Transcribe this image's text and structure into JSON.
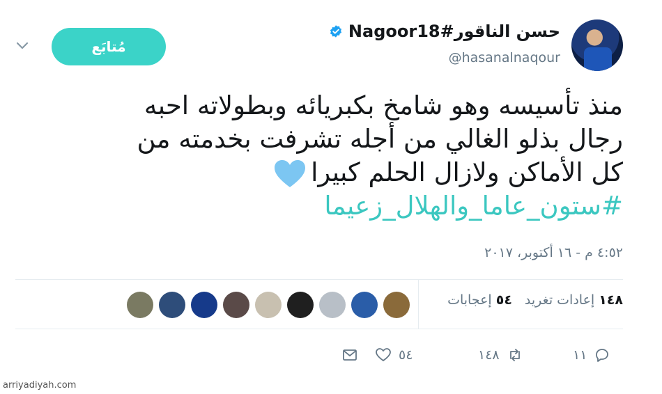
{
  "header": {
    "display_name": "حسن الناقور#Nagoor18",
    "handle": "@hasanalnaqour",
    "follow_label": "مُتابَع",
    "verified": true
  },
  "tweet": {
    "lines": [
      "منذ تأسيسه وهو شامخ بكبريائه وبطولاته احبه",
      "رجال بذلو الغالي من أجله تشرفت بخدمته من",
      "كل الأماكن ولازال الحلم كبيرا"
    ],
    "hashtag": "#ستون_عاما_والهلال_زعيما",
    "emoji": "blue-heart",
    "timestamp": "٤:٥٢ م - ١٦ أكتوبر، ٢٠١٧"
  },
  "stats": {
    "retweets_count": "١٤٨",
    "retweets_label": "إعادات تغريد",
    "likes_count": "٥٤",
    "likes_label": "إعجابات",
    "liker_avatars": [
      "#7a7a62",
      "#2e4d7a",
      "#163a8a",
      "#5a4a48",
      "#c8c0b0",
      "#1f1f1f",
      "#b8bfc7",
      "#2a5da8",
      "#8a6a3a"
    ]
  },
  "actions": {
    "replies": "١١",
    "retweets": "١٤٨",
    "likes": "٥٤"
  },
  "colors": {
    "accent": "#3bd3c8",
    "hashtag": "#3bc7c0",
    "muted": "#657786",
    "verified": "#1da1f2"
  },
  "watermark": "arriyadiyah.com"
}
